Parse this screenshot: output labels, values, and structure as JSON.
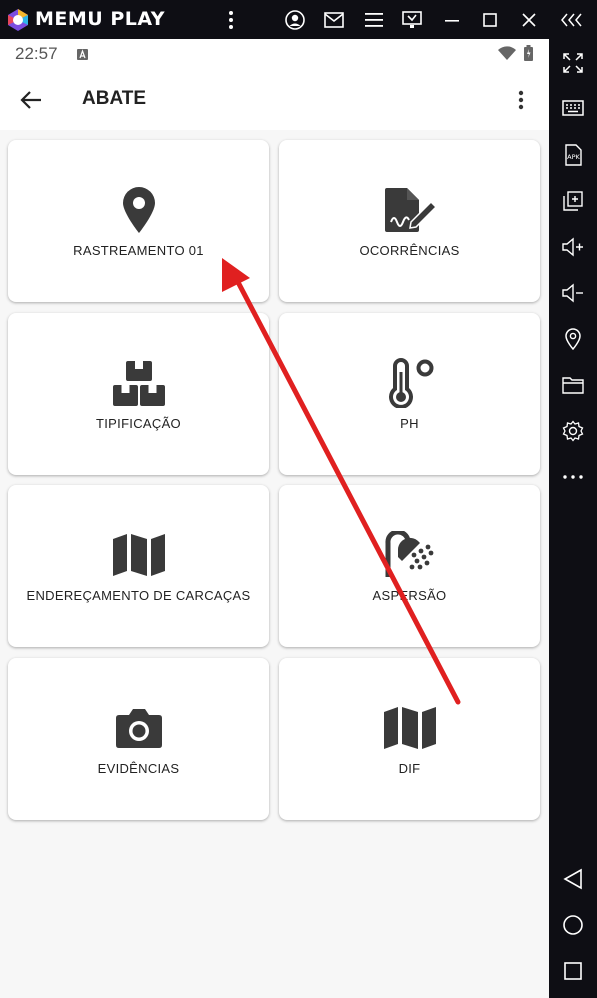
{
  "emulator": {
    "brand": "MEMU PLAY",
    "toolbar_icons": [
      "more-vert-icon",
      "account-icon",
      "mail-icon",
      "menu-icon",
      "screen-record-icon",
      "minimize-icon",
      "maximize-icon",
      "close-icon",
      "collapse-icon"
    ],
    "sidebar_icons": [
      "fullscreen-icon",
      "keyboard-icon",
      "apk-icon",
      "multi-window-icon",
      "volume-up-icon",
      "volume-down-icon",
      "location-icon",
      "folder-icon",
      "settings-icon",
      "more-horiz-icon"
    ],
    "nav_icons": [
      "back-triangle-icon",
      "home-circle-icon",
      "recents-square-icon"
    ],
    "apk_text": "APK"
  },
  "status_bar": {
    "time": "22:57"
  },
  "app_bar": {
    "title": "ABATE"
  },
  "tiles": [
    {
      "label": "RASTREAMENTO 01",
      "icon": "map-pin-icon"
    },
    {
      "label": "OCORRÊNCIAS",
      "icon": "file-signature-icon"
    },
    {
      "label": "TIPIFICAÇÃO",
      "icon": "boxes-icon"
    },
    {
      "label": "PH",
      "icon": "thermometer-icon"
    },
    {
      "label": "ENDEREÇAMENTO DE CARCAÇAS",
      "icon": "map-icon"
    },
    {
      "label": "ASPERSÃO",
      "icon": "shower-icon"
    },
    {
      "label": "EVIDÊNCIAS",
      "icon": "camera-icon"
    },
    {
      "label": "DIF",
      "icon": "map-icon"
    }
  ],
  "colors": {
    "emulator_bg": "#0e0e14",
    "screen_bg": "#f7f7f7",
    "card_bg": "#ffffff",
    "icon": "#3a3a3a",
    "annotation_arrow": "#e02020"
  }
}
